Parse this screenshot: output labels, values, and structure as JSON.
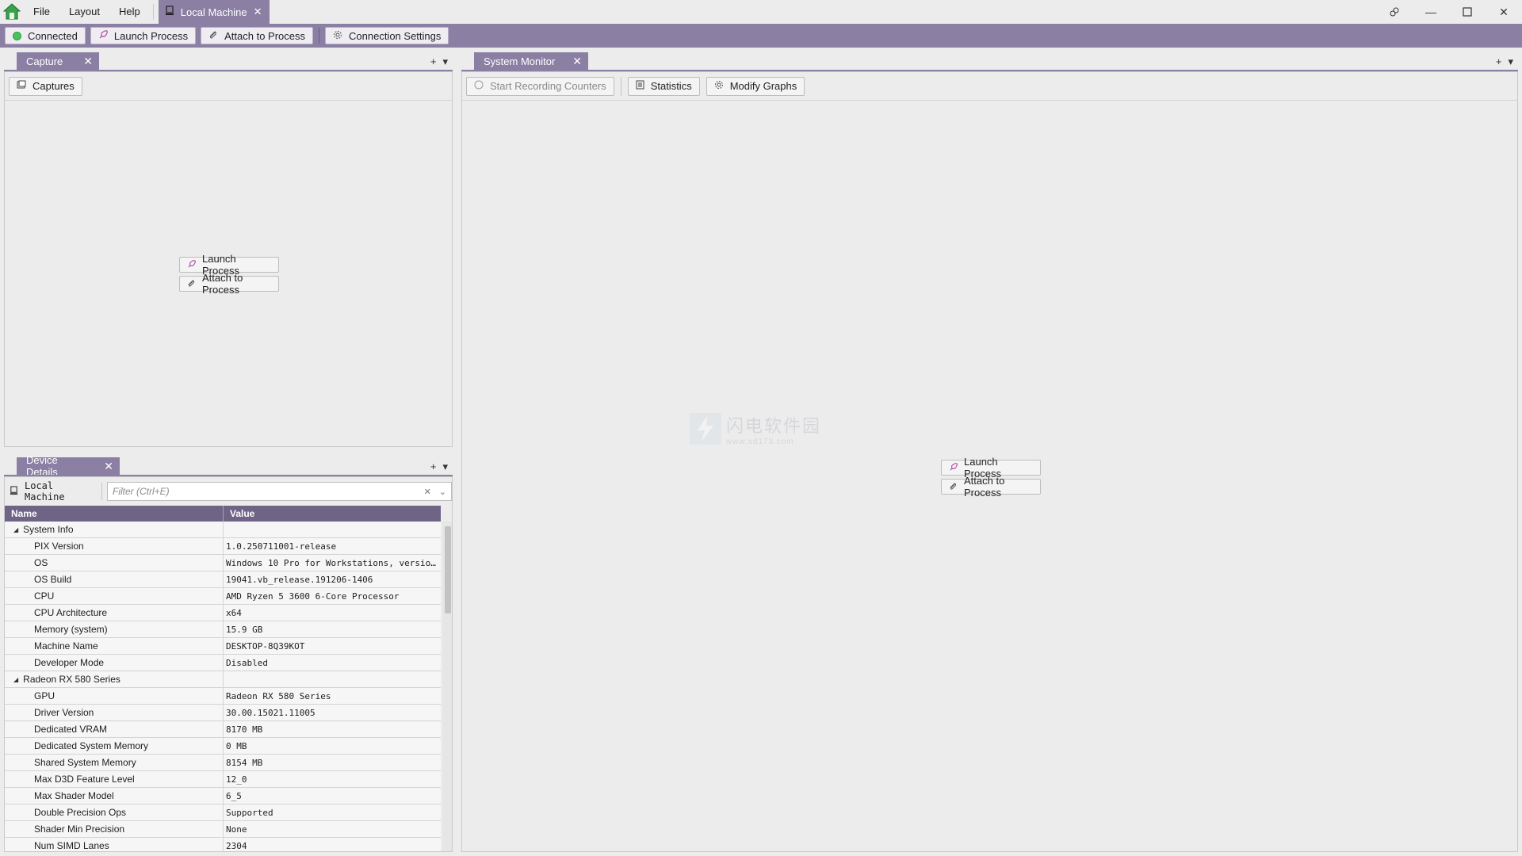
{
  "menu": {
    "file": "File",
    "layout": "Layout",
    "help": "Help"
  },
  "machine_tab": {
    "label": "Local Machine"
  },
  "connection_bar": {
    "connected": "Connected",
    "launch_process": "Launch Process",
    "attach_process": "Attach to Process",
    "connection_settings": "Connection Settings"
  },
  "capture_panel": {
    "tab_label": "Capture",
    "captures_button": "Captures",
    "launch_process": "Launch Process",
    "attach_process": "Attach to Process"
  },
  "system_monitor": {
    "tab_label": "System Monitor",
    "start_recording": "Start Recording Counters",
    "statistics": "Statistics",
    "modify_graphs": "Modify Graphs",
    "launch_process": "Launch Process",
    "attach_process": "Attach to Process"
  },
  "device_details": {
    "tab_label": "Device Details",
    "machine": "Local Machine",
    "filter_placeholder": "Filter (Ctrl+E)",
    "columns": {
      "name": "Name",
      "value": "Value"
    },
    "rows": [
      {
        "name": "System Info",
        "value": ""
      },
      {
        "name": "PIX Version",
        "value": "1.0.250711001-release"
      },
      {
        "name": "OS",
        "value": "Windows 10 Pro for Workstations, versio…"
      },
      {
        "name": "OS Build",
        "value": "19041.vb_release.191206-1406"
      },
      {
        "name": "CPU",
        "value": "AMD Ryzen 5 3600 6-Core Processor"
      },
      {
        "name": "CPU Architecture",
        "value": "x64"
      },
      {
        "name": "Memory (system)",
        "value": "15.9 GB"
      },
      {
        "name": "Machine Name",
        "value": "DESKTOP-8Q39KOT"
      },
      {
        "name": "Developer Mode",
        "value": "Disabled"
      },
      {
        "name": "Radeon RX 580 Series",
        "value": ""
      },
      {
        "name": "GPU",
        "value": "Radeon RX 580 Series"
      },
      {
        "name": "Driver Version",
        "value": "30.00.15021.11005"
      },
      {
        "name": "Dedicated VRAM",
        "value": "8170 MB"
      },
      {
        "name": "Dedicated System Memory",
        "value": "0 MB"
      },
      {
        "name": "Shared System Memory",
        "value": "8154 MB"
      },
      {
        "name": "Max D3D Feature Level",
        "value": "12_0"
      },
      {
        "name": "Max Shader Model",
        "value": "6_5"
      },
      {
        "name": "Double Precision Ops",
        "value": "Supported"
      },
      {
        "name": "Shader Min Precision",
        "value": "None"
      },
      {
        "name": "Num SIMD Lanes",
        "value": "2304"
      }
    ]
  },
  "watermark": {
    "main": "闪电软件园",
    "sub": "www.sd173.com"
  },
  "colors": {
    "accent": "#8b7fa3",
    "header": "#6f6386",
    "connected": "#46c35a"
  }
}
